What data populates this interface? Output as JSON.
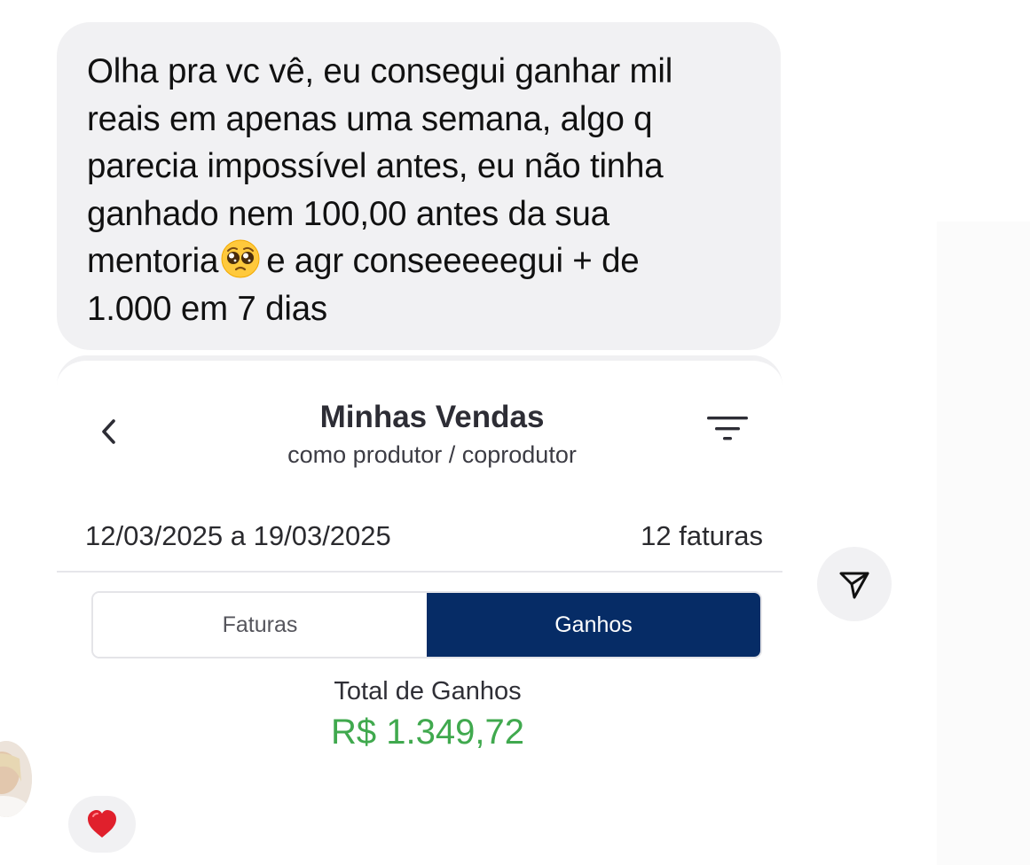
{
  "message": {
    "lines": [
      "Olha pra vc vê, eu consegui ganhar mil",
      "reais em apenas uma semana, algo q",
      "parecia impossível antes, eu não tinha",
      "ganhado nem 100,00 antes da sua"
    ],
    "line5_before_emoji": "mentoria",
    "line5_after_emoji": "e agr conseeeeegui + de",
    "line6": "1.000 em 7 dias",
    "emoji": "pleading-face"
  },
  "screenshot": {
    "title": "Minhas Vendas",
    "subtitle": "como produtor / coprodutor",
    "date_range": "12/03/2025 a 19/03/2025",
    "invoice_count": "12 faturas",
    "tabs": {
      "faturas": "Faturas",
      "ganhos": "Ganhos",
      "selected": "Ganhos"
    },
    "total_label": "Total de Ganhos",
    "total_value": "R$ 1.349,72",
    "colors": {
      "active_tab": "#062c66",
      "total_value": "#40a94e"
    }
  },
  "icons": {
    "back": "chevron-left-icon",
    "filter": "filter-icon",
    "share": "paper-plane-icon",
    "reaction": "red-heart-icon"
  },
  "colors": {
    "bubble_background": "#f1f1f3",
    "heart": "#e0202c"
  }
}
